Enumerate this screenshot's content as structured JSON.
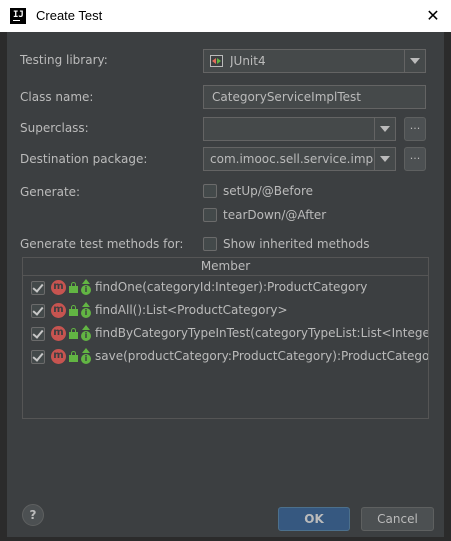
{
  "window": {
    "title": "Create Test",
    "close_glyph": "✕"
  },
  "form": {
    "testing_library_label": "Testing library:",
    "testing_library_value": "JUnit4",
    "class_name_label": "Class name:",
    "class_name_value": "CategoryServiceImplTest",
    "superclass_label": "Superclass:",
    "superclass_value": "",
    "destination_label": "Destination package:",
    "destination_value": "com.imooc.sell.service.impl",
    "ellipsis": "...",
    "generate_label": "Generate:",
    "setup_label": "setUp/@Before",
    "setup_checked": false,
    "teardown_label": "tearDown/@After",
    "teardown_checked": false,
    "methods_label": "Generate test methods for:",
    "show_inherited_label": "Show inherited methods",
    "show_inherited_checked": false
  },
  "table": {
    "header": "Member",
    "m_glyph": "m",
    "override_glyph": "i",
    "rows": [
      {
        "text": "findOne(categoryId:Integer):ProductCategory",
        "checked": true
      },
      {
        "text": "findAll():List<ProductCategory>",
        "checked": true
      },
      {
        "text": "findByCategoryTypeInTest(categoryTypeList:List<Integer>",
        "checked": true
      },
      {
        "text": "save(productCategory:ProductCategory):ProductCategory",
        "checked": true
      }
    ]
  },
  "footer": {
    "help_glyph": "?",
    "ok_label": "OK",
    "cancel_label": "Cancel"
  },
  "colors": {
    "dialog_bg": "#3c3f41",
    "ok_bg": "#365880",
    "method_icon": "#c75450",
    "access_icon": "#62b543"
  }
}
